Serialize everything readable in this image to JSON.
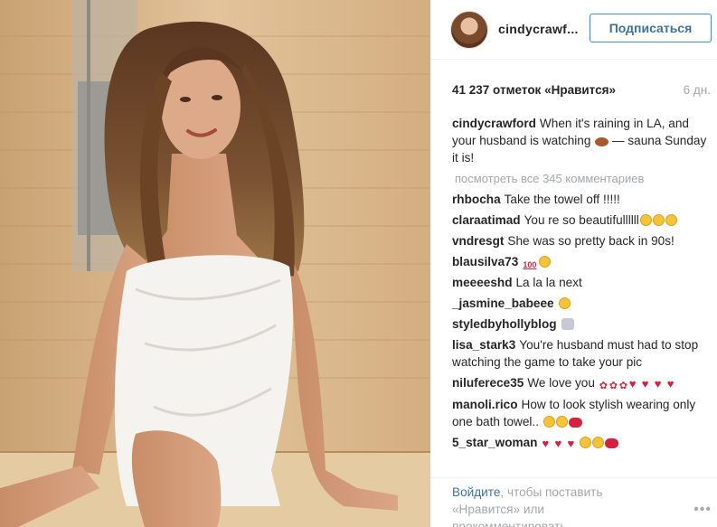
{
  "post": {
    "username_header": "cindycrawf...",
    "follow_label": "Подписаться",
    "likes_text": "41 237 отметок «Нравится»",
    "time_ago": "6 дн."
  },
  "caption": {
    "user": "cindycrawford",
    "text": "When it's raining in LA, and your husband is watching",
    "text_end": "— sauna Sunday it is!"
  },
  "view_all_label": "посмотреть все 345 комментариев",
  "comments": [
    {
      "user": "rhbocha",
      "text": "Take the towel off !!!!!"
    },
    {
      "user": "claraatimad",
      "text": "You re so beautifullllll"
    },
    {
      "user": "vndresgt",
      "text": "She was so pretty back in 90s!"
    },
    {
      "user": "blausilva73",
      "text": ""
    },
    {
      "user": "meeeeshd",
      "text": "La la la next"
    },
    {
      "user": "_jasmine_babeee",
      "text": ""
    },
    {
      "user": "styledbyhollyblog",
      "text": ""
    },
    {
      "user": "lisa_stark3",
      "text": "You're husband must had to stop watching the game to take your pic"
    },
    {
      "user": "niluferece35",
      "text": "We love you"
    },
    {
      "user": "manoli.rico",
      "text": "How to look stylish wearing only one bath towel.."
    },
    {
      "user": "5_star_woman",
      "text": ""
    }
  ],
  "footer": {
    "login_link": "Войдите",
    "login_rest": ", чтобы поставить «Нравится» или прокомментировать.",
    "more_icon": "•••"
  },
  "colors": {
    "accent": "#3f729b",
    "muted": "#a5a7aa",
    "text": "#262626"
  }
}
